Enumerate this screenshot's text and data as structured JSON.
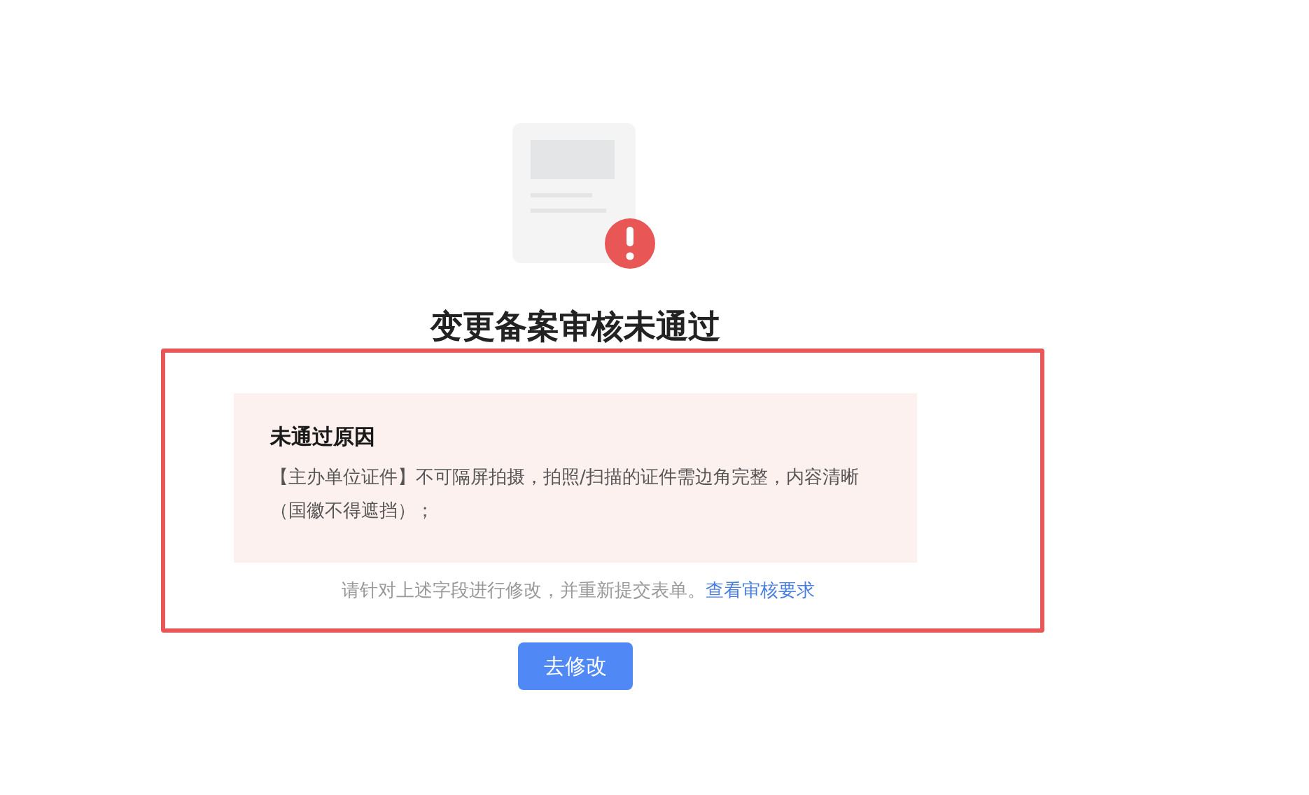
{
  "title": "变更备案审核未通过",
  "reason": {
    "heading": "未通过原因",
    "text": "【主办单位证件】不可隔屏拍摄，拍照/扫描的证件需边角完整，内容清晰（国徽不得遮挡）；"
  },
  "hint": {
    "text": "请针对上述字段进行修改，并重新提交表单。",
    "link": "查看审核要求"
  },
  "button": {
    "label": "去修改"
  }
}
